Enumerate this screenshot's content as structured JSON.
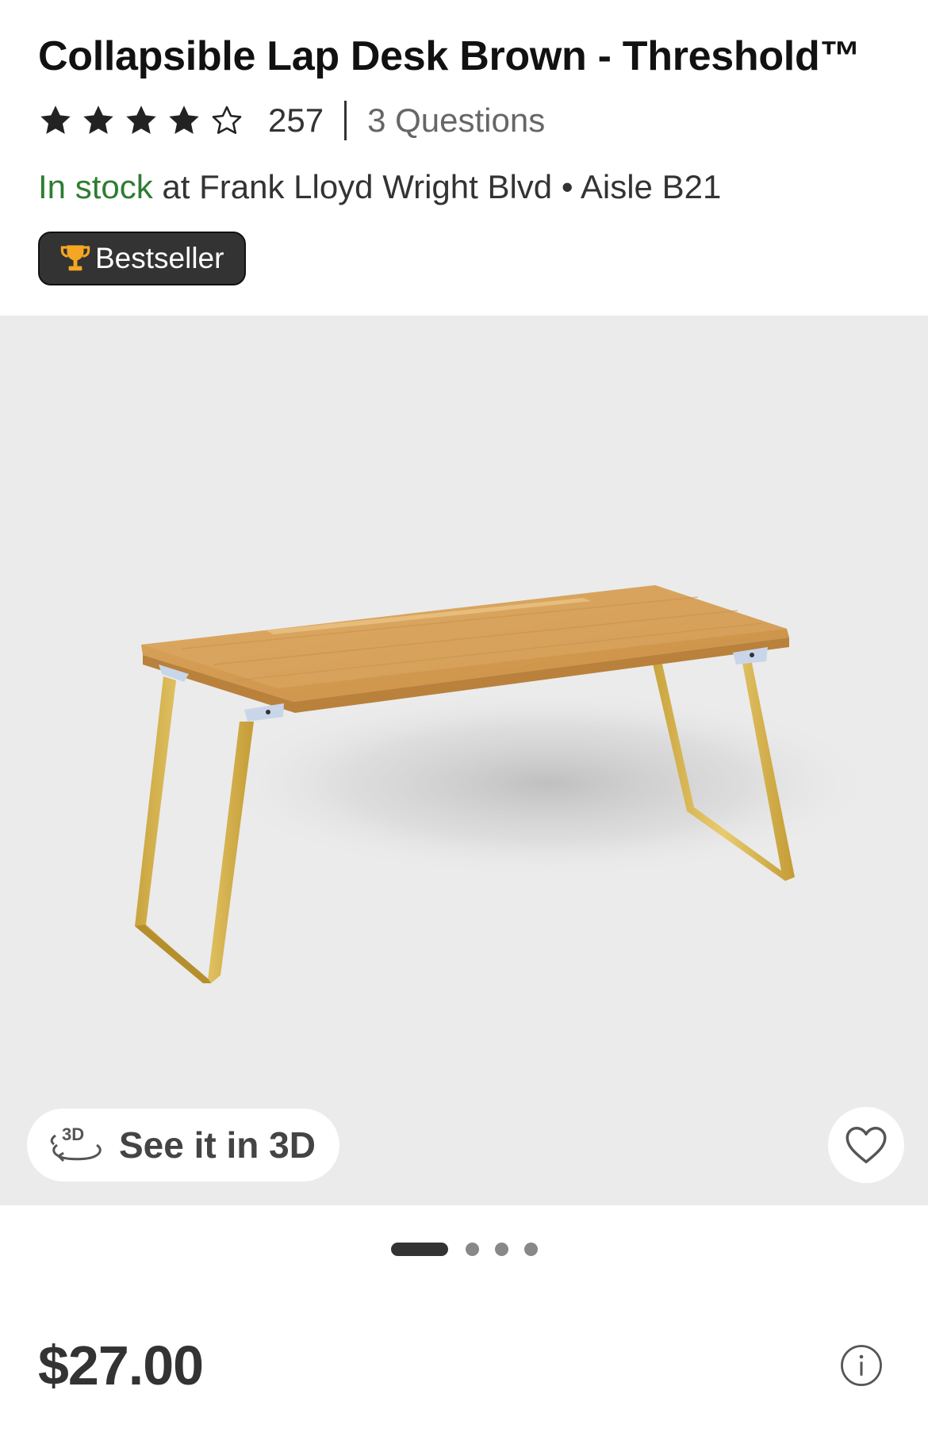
{
  "product": {
    "title": "Collapsible Lap Desk Brown - Threshold™",
    "rating": 4,
    "rating_max": 5,
    "review_count": "257",
    "questions": "3 Questions",
    "stock_status": "In stock",
    "store_location": " at Frank Lloyd Wright Blvd • Aisle B21",
    "badge": "Bestseller",
    "price": "$27.00"
  },
  "gallery": {
    "view_3d_label": "See it in 3D",
    "page_count": 4,
    "active_page": 1
  },
  "icons": {
    "stars": [
      "star-filled-icon",
      "star-filled-icon",
      "star-filled-icon",
      "star-filled-icon",
      "star-outline-icon"
    ],
    "badge": "trophy-icon",
    "view_3d": "rotate-3d-icon",
    "favorite": "heart-outline-icon",
    "info": "info-icon"
  },
  "colors": {
    "in_stock": "#2e7d32",
    "badge_bg": "#333333",
    "trophy": "#f5a623",
    "gallery_bg": "#ebebeb"
  }
}
